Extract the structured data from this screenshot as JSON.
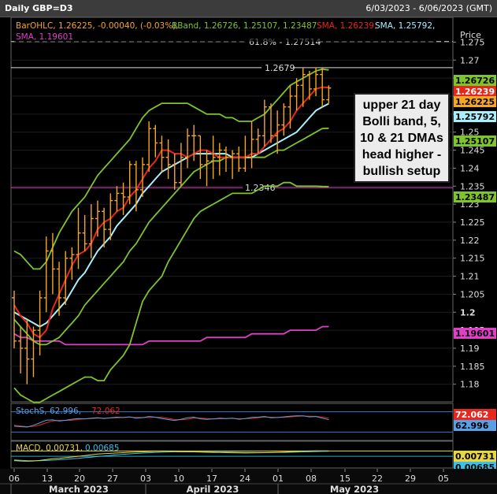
{
  "window": {
    "title": "Daily GBP=D3",
    "date_range": "6/03/2023 - 6/06/2023 (GMT)"
  },
  "annotation": {
    "text": "upper 21 day Bolli band, 5, 10 & 21 DMAs head higher - bullish setup"
  },
  "legend": {
    "main": [
      {
        "label": "BarOHLC, 1.26225, -0.00040, (-0.03%),",
        "color": "#f5a623"
      },
      {
        "label": "BBand, 1.26726, 1.25107, 1.23487",
        "color": "#7ec42b"
      },
      {
        "label": "SMA, 1.26239,",
        "color": "#e8271c"
      },
      {
        "label": "SMA, 1.25792,",
        "color": "#a9f0ff"
      },
      {
        "label": "SMA, 1.19601",
        "color": "#e040c8"
      }
    ],
    "stoch": [
      {
        "label": "StochS, 62.996,",
        "color": "#5aa0e6"
      },
      {
        "label": "72.062",
        "color": "#e8271c"
      }
    ],
    "macd": [
      {
        "label": "MACD, 0.00731,",
        "color": "#e8d640"
      },
      {
        "label": "0.00685",
        "color": "#3cc0e8"
      }
    ]
  },
  "axis": {
    "price_label": "Price",
    "y_ticks": [
      "1.275",
      "1.27",
      "1.265",
      "1.26",
      "1.255",
      "1.25",
      "1.245",
      "1.24",
      "1.235",
      "1.23",
      "1.225",
      "1.22",
      "1.215",
      "1.21",
      "1.205",
      "1.2",
      "1.195",
      "1.19",
      "1.185",
      "1.18"
    ],
    "x_ticks": [
      "06",
      "13",
      "20",
      "27",
      "03",
      "10",
      "17",
      "24",
      "01",
      "08",
      "15",
      "22",
      "29",
      "05"
    ],
    "months": [
      "March 2023",
      "April 2023",
      "May 2023"
    ]
  },
  "price_tags": [
    {
      "value": "1.26726",
      "bg": "#7ec42b",
      "fg": "#000"
    },
    {
      "value": "1.26239",
      "bg": "#e8271c",
      "fg": "#fff"
    },
    {
      "value": "1.26225",
      "bg": "#f5a623",
      "fg": "#000"
    },
    {
      "value": "1.25792",
      "bg": "#a9f0ff",
      "fg": "#000"
    },
    {
      "value": "1.25107",
      "bg": "#7ec42b",
      "fg": "#000"
    },
    {
      "value": "1.23487",
      "bg": "#7ec42b",
      "fg": "#000"
    },
    {
      "value": "1.19601",
      "bg": "#e040c8",
      "fg": "#000"
    }
  ],
  "lines": {
    "fib_label": "61.8% - 1.27514",
    "fib_value": 1.27514,
    "high_label": "1.2679",
    "high_value": 1.2679,
    "support_label": "1.2346",
    "support_value": 1.2346
  },
  "stoch_tags": [
    {
      "value": "72.062",
      "bg": "#e8271c",
      "fg": "#fff"
    },
    {
      "value": "62.996",
      "bg": "#5aa0e6",
      "fg": "#000"
    }
  ],
  "macd_tags": [
    {
      "value": "0.00731",
      "bg": "#e8d640",
      "fg": "#000"
    },
    {
      "value": "0.00685",
      "bg": "#3cc0e8",
      "fg": "#000"
    }
  ],
  "chart_data": {
    "type": "line",
    "title": "Daily GBP=D3",
    "ylim": [
      1.176,
      1.281
    ],
    "x_dates": [
      "03-06",
      "03-07",
      "03-08",
      "03-09",
      "03-10",
      "03-13",
      "03-14",
      "03-15",
      "03-16",
      "03-17",
      "03-20",
      "03-21",
      "03-22",
      "03-23",
      "03-24",
      "03-27",
      "03-28",
      "03-29",
      "03-30",
      "03-31",
      "04-03",
      "04-04",
      "04-05",
      "04-06",
      "04-07",
      "04-10",
      "04-11",
      "04-12",
      "04-13",
      "04-14",
      "04-17",
      "04-18",
      "04-19",
      "04-20",
      "04-21",
      "04-24",
      "04-25",
      "04-26",
      "04-27",
      "04-28",
      "05-01",
      "05-02",
      "05-03",
      "05-04",
      "05-05",
      "05-08",
      "05-09",
      "05-10",
      "05-11",
      "05-12"
    ],
    "ohlc": [
      [
        1.204,
        1.206,
        1.19,
        1.192
      ],
      [
        1.192,
        1.196,
        1.183,
        1.19
      ],
      [
        1.19,
        1.198,
        1.18,
        1.187
      ],
      [
        1.187,
        1.196,
        1.182,
        1.195
      ],
      [
        1.195,
        1.206,
        1.188,
        1.204
      ],
      [
        1.204,
        1.221,
        1.2,
        1.217
      ],
      [
        1.217,
        1.222,
        1.205,
        1.212
      ],
      [
        1.212,
        1.214,
        1.199,
        1.204
      ],
      [
        1.204,
        1.217,
        1.202,
        1.215
      ],
      [
        1.215,
        1.218,
        1.209,
        1.216
      ],
      [
        1.216,
        1.229,
        1.212,
        1.222
      ],
      [
        1.222,
        1.227,
        1.217,
        1.219
      ],
      [
        1.219,
        1.23,
        1.215,
        1.226
      ],
      [
        1.226,
        1.231,
        1.221,
        1.228
      ],
      [
        1.228,
        1.229,
        1.218,
        1.223
      ],
      [
        1.223,
        1.233,
        1.22,
        1.231
      ],
      [
        1.231,
        1.235,
        1.228,
        1.233
      ],
      [
        1.233,
        1.236,
        1.227,
        1.232
      ],
      [
        1.232,
        1.242,
        1.23,
        1.241
      ],
      [
        1.241,
        1.242,
        1.228,
        1.234
      ],
      [
        1.234,
        1.243,
        1.232,
        1.241
      ],
      [
        1.241,
        1.253,
        1.239,
        1.251
      ],
      [
        1.251,
        1.252,
        1.243,
        1.247
      ],
      [
        1.247,
        1.249,
        1.239,
        1.243
      ],
      [
        1.243,
        1.248,
        1.237,
        1.241
      ],
      [
        1.241,
        1.244,
        1.234,
        1.236
      ],
      [
        1.236,
        1.247,
        1.235,
        1.243
      ],
      [
        1.243,
        1.251,
        1.24,
        1.249
      ],
      [
        1.249,
        1.252,
        1.242,
        1.249
      ],
      [
        1.249,
        1.249,
        1.237,
        1.241
      ],
      [
        1.241,
        1.245,
        1.235,
        1.242
      ],
      [
        1.242,
        1.249,
        1.237,
        1.243
      ],
      [
        1.243,
        1.247,
        1.238,
        1.245
      ],
      [
        1.245,
        1.246,
        1.239,
        1.243
      ],
      [
        1.243,
        1.245,
        1.237,
        1.244
      ],
      [
        1.244,
        1.246,
        1.239,
        1.24
      ],
      [
        1.24,
        1.249,
        1.239,
        1.243
      ],
      [
        1.243,
        1.253,
        1.24,
        1.248
      ],
      [
        1.248,
        1.251,
        1.244,
        1.249
      ],
      [
        1.249,
        1.259,
        1.246,
        1.257
      ],
      [
        1.257,
        1.258,
        1.247,
        1.249
      ],
      [
        1.249,
        1.256,
        1.244,
        1.252
      ],
      [
        1.252,
        1.258,
        1.249,
        1.257
      ],
      [
        1.257,
        1.263,
        1.251,
        1.26
      ],
      [
        1.26,
        1.265,
        1.256,
        1.263
      ],
      [
        1.263,
        1.268,
        1.257,
        1.266
      ],
      [
        1.266,
        1.267,
        1.259,
        1.262
      ],
      [
        1.262,
        1.268,
        1.26,
        1.266
      ],
      [
        1.266,
        1.268,
        1.257,
        1.259
      ],
      [
        1.259,
        1.263,
        1.258,
        1.26225
      ]
    ],
    "series": [
      {
        "name": "SMA, 1.26239",
        "color": "#e8271c",
        "values": [
          1.202,
          1.199,
          1.197,
          1.194,
          1.193,
          1.195,
          1.201,
          1.205,
          1.209,
          1.213,
          1.216,
          1.217,
          1.219,
          1.223,
          1.225,
          1.226,
          1.228,
          1.229,
          1.232,
          1.234,
          1.237,
          1.24,
          1.242,
          1.245,
          1.245,
          1.244,
          1.244,
          1.243,
          1.244,
          1.245,
          1.245,
          1.244,
          1.243,
          1.243,
          1.243,
          1.243,
          1.243,
          1.244,
          1.244,
          1.246,
          1.248,
          1.25,
          1.251,
          1.253,
          1.256,
          1.258,
          1.26,
          1.262,
          1.2625,
          1.26239
        ]
      },
      {
        "name": "SMA, 1.25792",
        "color": "#a9f0ff",
        "values": [
          1.2,
          1.199,
          1.198,
          1.197,
          1.196,
          1.197,
          1.199,
          1.201,
          1.203,
          1.206,
          1.209,
          1.211,
          1.214,
          1.217,
          1.219,
          1.221,
          1.224,
          1.226,
          1.228,
          1.23,
          1.233,
          1.235,
          1.237,
          1.239,
          1.24,
          1.241,
          1.242,
          1.243,
          1.244,
          1.244,
          1.244,
          1.244,
          1.244,
          1.244,
          1.243,
          1.243,
          1.243,
          1.243,
          1.244,
          1.245,
          1.246,
          1.247,
          1.248,
          1.249,
          1.25,
          1.252,
          1.254,
          1.256,
          1.257,
          1.25792
        ]
      },
      {
        "name": "BBand upper, 1.26726",
        "color": "#7ec42b",
        "values": [
          1.217,
          1.216,
          1.214,
          1.212,
          1.212,
          1.214,
          1.218,
          1.222,
          1.225,
          1.228,
          1.23,
          1.232,
          1.235,
          1.238,
          1.24,
          1.242,
          1.244,
          1.246,
          1.248,
          1.251,
          1.254,
          1.256,
          1.257,
          1.258,
          1.258,
          1.258,
          1.258,
          1.258,
          1.257,
          1.256,
          1.255,
          1.255,
          1.255,
          1.254,
          1.254,
          1.253,
          1.253,
          1.253,
          1.254,
          1.255,
          1.257,
          1.259,
          1.261,
          1.263,
          1.264,
          1.265,
          1.266,
          1.267,
          1.2675,
          1.26726
        ]
      },
      {
        "name": "BBand middle, 1.25107",
        "color": "#7ec42b",
        "values": [
          1.198,
          1.196,
          1.194,
          1.192,
          1.191,
          1.191,
          1.192,
          1.193,
          1.195,
          1.197,
          1.199,
          1.202,
          1.204,
          1.206,
          1.208,
          1.21,
          1.212,
          1.214,
          1.217,
          1.219,
          1.222,
          1.225,
          1.227,
          1.229,
          1.231,
          1.233,
          1.235,
          1.237,
          1.239,
          1.24,
          1.241,
          1.242,
          1.242,
          1.243,
          1.243,
          1.243,
          1.243,
          1.243,
          1.243,
          1.243,
          1.244,
          1.245,
          1.245,
          1.246,
          1.247,
          1.248,
          1.249,
          1.25,
          1.251,
          1.25107
        ]
      },
      {
        "name": "BBand lower, 1.23487",
        "color": "#7ec42b",
        "values": [
          1.179,
          1.177,
          1.176,
          1.175,
          1.175,
          1.176,
          1.177,
          1.178,
          1.179,
          1.18,
          1.181,
          1.182,
          1.182,
          1.181,
          1.181,
          1.184,
          1.186,
          1.188,
          1.191,
          1.197,
          1.203,
          1.206,
          1.208,
          1.21,
          1.214,
          1.217,
          1.22,
          1.223,
          1.226,
          1.228,
          1.229,
          1.23,
          1.231,
          1.232,
          1.233,
          1.233,
          1.233,
          1.233,
          1.234,
          1.235,
          1.235,
          1.235,
          1.236,
          1.236,
          1.235,
          1.235,
          1.235,
          1.235,
          1.2349,
          1.23487
        ]
      },
      {
        "name": "SMA, 1.19601",
        "color": "#e040c8",
        "values": [
          1.194,
          1.193,
          1.193,
          1.192,
          1.192,
          1.192,
          1.192,
          1.192,
          1.191,
          1.191,
          1.191,
          1.191,
          1.191,
          1.191,
          1.191,
          1.191,
          1.191,
          1.191,
          1.191,
          1.191,
          1.191,
          1.192,
          1.192,
          1.192,
          1.192,
          1.192,
          1.192,
          1.192,
          1.192,
          1.192,
          1.193,
          1.193,
          1.193,
          1.193,
          1.193,
          1.193,
          1.193,
          1.194,
          1.194,
          1.194,
          1.194,
          1.194,
          1.194,
          1.195,
          1.195,
          1.195,
          1.195,
          1.195,
          1.196,
          1.19601
        ]
      }
    ],
    "stoch": {
      "ylim": [
        0,
        100
      ],
      "k_color": "#5aa0e6",
      "d_color": "#e8271c",
      "k": [
        25,
        22,
        20,
        30,
        45,
        60,
        62,
        55,
        60,
        66,
        70,
        68,
        72,
        75,
        70,
        74,
        78,
        76,
        80,
        72,
        75,
        82,
        78,
        70,
        64,
        58,
        66,
        74,
        78,
        68,
        65,
        68,
        72,
        70,
        72,
        66,
        70,
        76,
        78,
        82,
        74,
        76,
        80,
        84,
        86,
        86,
        80,
        82,
        72,
        62.996
      ],
      "d": [
        30,
        26,
        22,
        24,
        32,
        45,
        56,
        59,
        59,
        60,
        65,
        68,
        70,
        72,
        72,
        73,
        74,
        76,
        78,
        76,
        76,
        76,
        78,
        77,
        71,
        64,
        63,
        66,
        73,
        73,
        70,
        67,
        68,
        70,
        71,
        69,
        69,
        71,
        75,
        79,
        78,
        77,
        77,
        80,
        83,
        85,
        84,
        83,
        78,
        72.062
      ]
    },
    "macd": {
      "macd_color": "#e8d640",
      "signal_color": "#3cc0e8",
      "macd": [
        -0.006,
        -0.0065,
        -0.0068,
        -0.0065,
        -0.0058,
        -0.0045,
        -0.0035,
        -0.003,
        -0.002,
        -0.001,
        0.0,
        0.001,
        0.002,
        0.003,
        0.0035,
        0.004,
        0.0045,
        0.005,
        0.0055,
        0.0058,
        0.006,
        0.0065,
        0.0068,
        0.007,
        0.0068,
        0.0065,
        0.0062,
        0.006,
        0.006,
        0.0058,
        0.0055,
        0.0053,
        0.0052,
        0.005,
        0.0048,
        0.0046,
        0.0045,
        0.0046,
        0.0048,
        0.005,
        0.0052,
        0.0055,
        0.0058,
        0.0062,
        0.0066,
        0.007,
        0.0072,
        0.0074,
        0.0074,
        0.00731
      ],
      "signal": [
        -0.005,
        -0.0055,
        -0.006,
        -0.0062,
        -0.0061,
        -0.0058,
        -0.0053,
        -0.0048,
        -0.0042,
        -0.0035,
        -0.0028,
        -0.002,
        -0.0012,
        -0.0004,
        0.0004,
        0.0012,
        0.002,
        0.0027,
        0.0033,
        0.0039,
        0.0044,
        0.0048,
        0.0052,
        0.0056,
        0.0059,
        0.0061,
        0.0062,
        0.0062,
        0.0062,
        0.0061,
        0.006,
        0.0059,
        0.0058,
        0.0057,
        0.0056,
        0.0054,
        0.0053,
        0.0052,
        0.0051,
        0.0051,
        0.0051,
        0.0052,
        0.0053,
        0.0055,
        0.0057,
        0.006,
        0.0062,
        0.0065,
        0.0067,
        0.00685
      ]
    }
  }
}
